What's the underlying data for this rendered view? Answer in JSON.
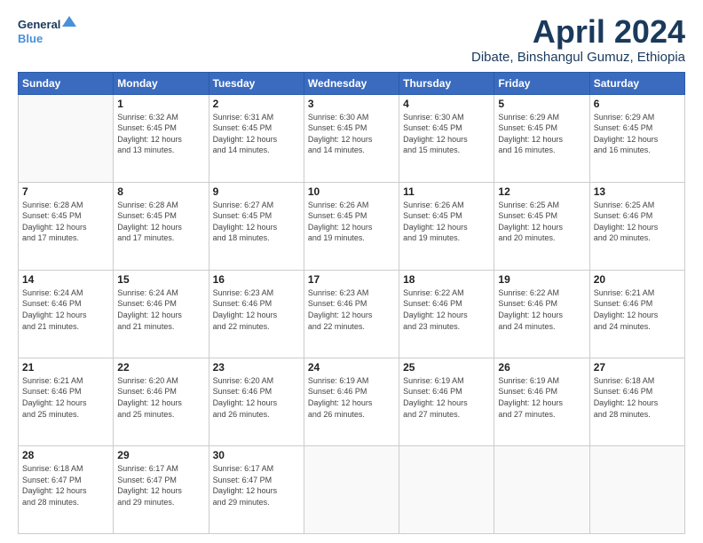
{
  "logo": {
    "line1": "General",
    "line2": "Blue"
  },
  "title": "April 2024",
  "location": "Dibate, Binshangul Gumuz, Ethiopia",
  "days_of_week": [
    "Sunday",
    "Monday",
    "Tuesday",
    "Wednesday",
    "Thursday",
    "Friday",
    "Saturday"
  ],
  "weeks": [
    [
      {
        "day": "",
        "info": ""
      },
      {
        "day": "1",
        "info": "Sunrise: 6:32 AM\nSunset: 6:45 PM\nDaylight: 12 hours\nand 13 minutes."
      },
      {
        "day": "2",
        "info": "Sunrise: 6:31 AM\nSunset: 6:45 PM\nDaylight: 12 hours\nand 14 minutes."
      },
      {
        "day": "3",
        "info": "Sunrise: 6:30 AM\nSunset: 6:45 PM\nDaylight: 12 hours\nand 14 minutes."
      },
      {
        "day": "4",
        "info": "Sunrise: 6:30 AM\nSunset: 6:45 PM\nDaylight: 12 hours\nand 15 minutes."
      },
      {
        "day": "5",
        "info": "Sunrise: 6:29 AM\nSunset: 6:45 PM\nDaylight: 12 hours\nand 16 minutes."
      },
      {
        "day": "6",
        "info": "Sunrise: 6:29 AM\nSunset: 6:45 PM\nDaylight: 12 hours\nand 16 minutes."
      }
    ],
    [
      {
        "day": "7",
        "info": "Sunrise: 6:28 AM\nSunset: 6:45 PM\nDaylight: 12 hours\nand 17 minutes."
      },
      {
        "day": "8",
        "info": "Sunrise: 6:28 AM\nSunset: 6:45 PM\nDaylight: 12 hours\nand 17 minutes."
      },
      {
        "day": "9",
        "info": "Sunrise: 6:27 AM\nSunset: 6:45 PM\nDaylight: 12 hours\nand 18 minutes."
      },
      {
        "day": "10",
        "info": "Sunrise: 6:26 AM\nSunset: 6:45 PM\nDaylight: 12 hours\nand 19 minutes."
      },
      {
        "day": "11",
        "info": "Sunrise: 6:26 AM\nSunset: 6:45 PM\nDaylight: 12 hours\nand 19 minutes."
      },
      {
        "day": "12",
        "info": "Sunrise: 6:25 AM\nSunset: 6:45 PM\nDaylight: 12 hours\nand 20 minutes."
      },
      {
        "day": "13",
        "info": "Sunrise: 6:25 AM\nSunset: 6:46 PM\nDaylight: 12 hours\nand 20 minutes."
      }
    ],
    [
      {
        "day": "14",
        "info": "Sunrise: 6:24 AM\nSunset: 6:46 PM\nDaylight: 12 hours\nand 21 minutes."
      },
      {
        "day": "15",
        "info": "Sunrise: 6:24 AM\nSunset: 6:46 PM\nDaylight: 12 hours\nand 21 minutes."
      },
      {
        "day": "16",
        "info": "Sunrise: 6:23 AM\nSunset: 6:46 PM\nDaylight: 12 hours\nand 22 minutes."
      },
      {
        "day": "17",
        "info": "Sunrise: 6:23 AM\nSunset: 6:46 PM\nDaylight: 12 hours\nand 22 minutes."
      },
      {
        "day": "18",
        "info": "Sunrise: 6:22 AM\nSunset: 6:46 PM\nDaylight: 12 hours\nand 23 minutes."
      },
      {
        "day": "19",
        "info": "Sunrise: 6:22 AM\nSunset: 6:46 PM\nDaylight: 12 hours\nand 24 minutes."
      },
      {
        "day": "20",
        "info": "Sunrise: 6:21 AM\nSunset: 6:46 PM\nDaylight: 12 hours\nand 24 minutes."
      }
    ],
    [
      {
        "day": "21",
        "info": "Sunrise: 6:21 AM\nSunset: 6:46 PM\nDaylight: 12 hours\nand 25 minutes."
      },
      {
        "day": "22",
        "info": "Sunrise: 6:20 AM\nSunset: 6:46 PM\nDaylight: 12 hours\nand 25 minutes."
      },
      {
        "day": "23",
        "info": "Sunrise: 6:20 AM\nSunset: 6:46 PM\nDaylight: 12 hours\nand 26 minutes."
      },
      {
        "day": "24",
        "info": "Sunrise: 6:19 AM\nSunset: 6:46 PM\nDaylight: 12 hours\nand 26 minutes."
      },
      {
        "day": "25",
        "info": "Sunrise: 6:19 AM\nSunset: 6:46 PM\nDaylight: 12 hours\nand 27 minutes."
      },
      {
        "day": "26",
        "info": "Sunrise: 6:19 AM\nSunset: 6:46 PM\nDaylight: 12 hours\nand 27 minutes."
      },
      {
        "day": "27",
        "info": "Sunrise: 6:18 AM\nSunset: 6:46 PM\nDaylight: 12 hours\nand 28 minutes."
      }
    ],
    [
      {
        "day": "28",
        "info": "Sunrise: 6:18 AM\nSunset: 6:47 PM\nDaylight: 12 hours\nand 28 minutes."
      },
      {
        "day": "29",
        "info": "Sunrise: 6:17 AM\nSunset: 6:47 PM\nDaylight: 12 hours\nand 29 minutes."
      },
      {
        "day": "30",
        "info": "Sunrise: 6:17 AM\nSunset: 6:47 PM\nDaylight: 12 hours\nand 29 minutes."
      },
      {
        "day": "",
        "info": ""
      },
      {
        "day": "",
        "info": ""
      },
      {
        "day": "",
        "info": ""
      },
      {
        "day": "",
        "info": ""
      }
    ]
  ]
}
